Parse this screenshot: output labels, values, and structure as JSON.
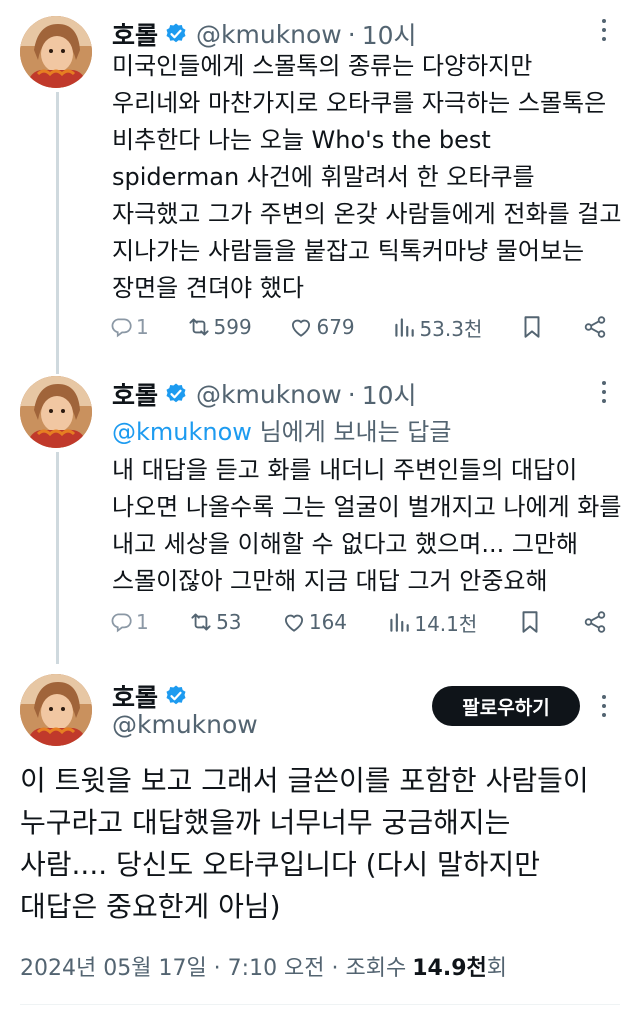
{
  "author": {
    "name": "호롤",
    "handle": "@kmuknow"
  },
  "tweets": [
    {
      "time": "10시",
      "text": "미국인들에게 스몰톡의 종류는 다양하지만\n우리네와 마찬가지로 오타쿠를 자극하는 스몰톡은\n비추한다 나는 오늘 Who's the best\nspiderman 사건에 휘말려서 한 오타쿠를\n자극했고 그가 주변의 온갖 사람들에게 전화를 걸고\n지나가는 사람들을 붙잡고 틱톡커마냥 물어보는\n장면을 견뎌야 했다",
      "replies": "1",
      "retweets": "599",
      "likes": "679",
      "views": "53.3천"
    },
    {
      "time": "10시",
      "reply_to_mention": "@kmuknow",
      "reply_to_suffix": "님에게 보내는 답글",
      "text": "내 대답을 듣고 화를 내더니 주변인들의 대답이\n나오면 나올수록 그는 얼굴이 벌개지고 나에게 화를\n내고 세상을 이해할 수 없다고 했으며... 그만해\n스몰이잖아 그만해 지금 대답 그거 안중요해",
      "replies": "1",
      "retweets": "53",
      "likes": "164",
      "views": "14.1천"
    }
  ],
  "main_tweet": {
    "follow_label": "팔로우하기",
    "text": "이 트윗을 보고 그래서 글쓴이를 포함한 사람들이\n누구라고 대답했을까 너무너무 궁금해지는\n사람.... 당신도 오타쿠입니다 (다시 말하지만\n대답은 중요한게 아님)",
    "timestamp": "2024년 05월 17일 · 7:10 오전 · 조회수",
    "views_count": "14.9천",
    "views_suffix": "회"
  },
  "colors": {
    "text": "#0f1419",
    "secondary": "#536471",
    "accent": "#1d9bf0",
    "thread_line": "#cfd9de"
  }
}
